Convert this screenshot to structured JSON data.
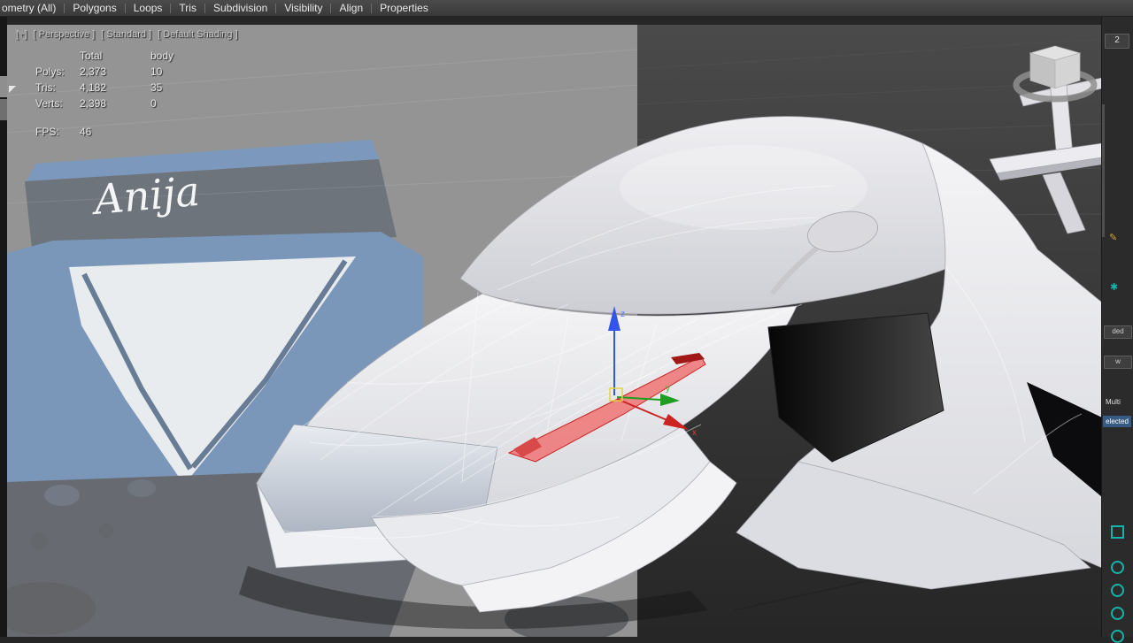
{
  "menu": {
    "items": [
      "ometry (All)",
      "Polygons",
      "Loops",
      "Tris",
      "Subdivision",
      "Visibility",
      "Align",
      "Properties"
    ]
  },
  "viewport": {
    "label": {
      "menu_plus": "[+]",
      "pov": "[ Perspective ]",
      "render_preset": "[ Standard ]",
      "shading": "[ Default Shading ]"
    },
    "stats": {
      "col_total": "Total",
      "col_body": "body",
      "rows": [
        {
          "label": "Polys:",
          "total": "2,373",
          "body": "10"
        },
        {
          "label": "Tris:",
          "total": "4,182",
          "body": "35"
        },
        {
          "label": "Verts:",
          "total": "2,398",
          "body": "0"
        }
      ],
      "fps_label": "FPS:",
      "fps_value": "46"
    },
    "reference": {
      "windshield_text": "Anija"
    },
    "gizmo": {
      "x_label": "x",
      "y_label": "y",
      "z_label": "z"
    }
  },
  "right_panel": {
    "top_value": "2",
    "fragment_1": "ded",
    "fragment_2": "w",
    "multi_label": "Multi",
    "selected_label": "elected",
    "teal_icon_shapes": [
      "asterisk",
      "square",
      "circle",
      "circle",
      "circle"
    ]
  },
  "colors": {
    "axis_x": "#cc2222",
    "axis_y": "#1f9e1f",
    "axis_z": "#3355ee",
    "selection_fill": "#ee7b7b",
    "teal_icon": "#18b3a8",
    "viewport_bg_dark": "#3a3a3a"
  }
}
